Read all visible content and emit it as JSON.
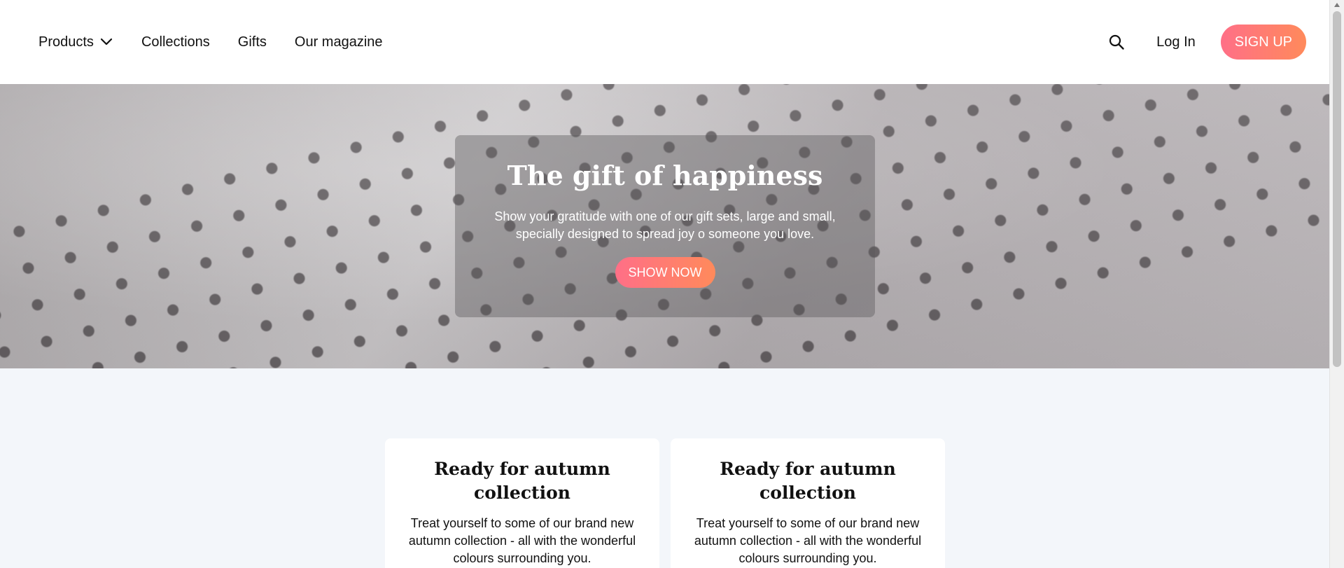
{
  "nav": {
    "items": [
      {
        "label": "Products",
        "has_dropdown": true
      },
      {
        "label": "Collections"
      },
      {
        "label": "Gifts"
      },
      {
        "label": "Our magazine"
      }
    ],
    "login_label": "Log In",
    "signup_label": "SIGN UP",
    "search_icon": "search-icon"
  },
  "hero": {
    "title": "The gift of happiness",
    "text": "Show your gratitude with one of our gift sets, large and small, specially designed to spread joy o someone you love.",
    "button_label": "SHOW NOW"
  },
  "cards": [
    {
      "title": "Ready for autumn collection",
      "text": "Treat yourself to some of our brand new autumn collection - all with the wonderful colours surrounding you."
    },
    {
      "title": "Ready for autumn collection",
      "text": "Treat yourself to some of our brand new autumn collection - all with the wonderful colours surrounding you."
    }
  ],
  "colors": {
    "accent_start": "#ff6f87",
    "accent_end": "#ff8a5b",
    "page_bg": "#f3f6fa"
  }
}
